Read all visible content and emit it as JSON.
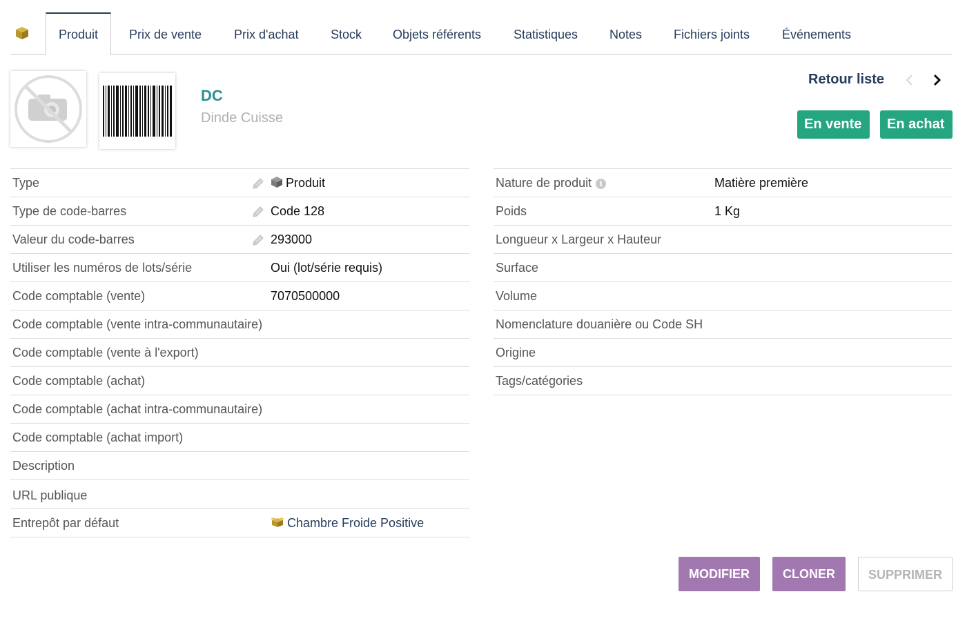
{
  "tabs": [
    {
      "label": "Produit"
    },
    {
      "label": "Prix de vente"
    },
    {
      "label": "Prix d'achat"
    },
    {
      "label": "Stock"
    },
    {
      "label": "Objets référents"
    },
    {
      "label": "Statistiques"
    },
    {
      "label": "Notes"
    },
    {
      "label": "Fichiers joints"
    },
    {
      "label": "Événements"
    }
  ],
  "product": {
    "ref": "DC",
    "label": "Dinde Cuisse"
  },
  "nav": {
    "back_label": "Retour liste"
  },
  "status": {
    "sell": "En vente",
    "buy": "En achat",
    "color": "#25a580"
  },
  "left_fields": [
    {
      "label": "Type",
      "value": "Produit"
    },
    {
      "label": "Type de code-barres",
      "value": "Code 128"
    },
    {
      "label": "Valeur du code-barres",
      "value": "293000"
    },
    {
      "label": "Utiliser les numéros de lots/série",
      "value": "Oui (lot/série requis)"
    },
    {
      "label": "Code comptable (vente)",
      "value": "7070500000"
    },
    {
      "label": "Code comptable (vente intra-communautaire)",
      "value": ""
    },
    {
      "label": "Code comptable (vente à l'export)",
      "value": ""
    },
    {
      "label": "Code comptable (achat)",
      "value": ""
    },
    {
      "label": "Code comptable (achat intra-communautaire)",
      "value": ""
    },
    {
      "label": "Code comptable (achat import)",
      "value": ""
    },
    {
      "label": "Description",
      "value": ""
    },
    {
      "label": "URL publique",
      "value": ""
    },
    {
      "label": "Entrepôt par défaut",
      "value": "Chambre Froide Positive"
    }
  ],
  "right_fields": [
    {
      "label": "Nature de produit",
      "value": "Matière première"
    },
    {
      "label": "Poids",
      "value": "1 Kg"
    },
    {
      "label": "Longueur x Largeur x Hauteur",
      "value": ""
    },
    {
      "label": "Surface",
      "value": ""
    },
    {
      "label": "Volume",
      "value": ""
    },
    {
      "label": "Nomenclature douanière ou Code SH",
      "value": ""
    },
    {
      "label": "Origine",
      "value": ""
    },
    {
      "label": "Tags/catégories",
      "value": ""
    }
  ],
  "actions": {
    "modify": "MODIFIER",
    "clone": "CLONER",
    "delete": "SUPPRIMER"
  },
  "icons": {
    "tab_product": "product-box-icon",
    "no_photo": "no-photo-icon",
    "barcode": "barcode-icon",
    "edit": "pencil-icon",
    "warehouse": "warehouse-icon",
    "info": "info-icon"
  },
  "colors": {
    "accent": "#263c5c",
    "ref": "#2a8f8f",
    "button": "#a278b0"
  }
}
